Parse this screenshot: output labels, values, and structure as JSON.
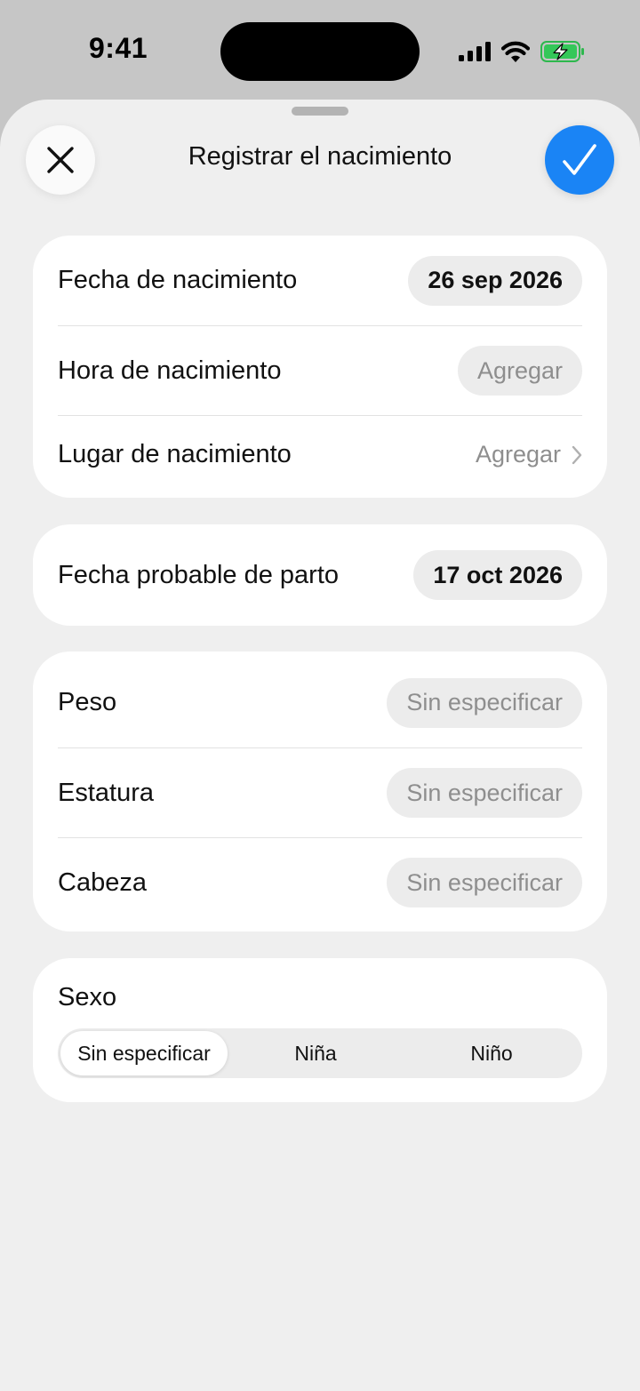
{
  "status_bar": {
    "time": "9:41"
  },
  "header": {
    "title": "Registrar el nacimiento",
    "close_icon": "close-icon",
    "confirm_icon": "checkmark-icon",
    "accent_color": "#1a84f5"
  },
  "birth_card": {
    "fecha_label": "Fecha de nacimiento",
    "fecha_value": "26 sep 2026",
    "hora_label": "Hora de nacimiento",
    "hora_value": "Agregar",
    "lugar_label": "Lugar de nacimiento",
    "lugar_value": "Agregar"
  },
  "due_card": {
    "label": "Fecha probable de parto",
    "value": "17 oct 2026"
  },
  "measures_card": {
    "peso_label": "Peso",
    "peso_value": "Sin especificar",
    "estatura_label": "Estatura",
    "estatura_value": "Sin especificar",
    "cabeza_label": "Cabeza",
    "cabeza_value": "Sin especificar"
  },
  "sex_card": {
    "label": "Sexo",
    "options": [
      "Sin especificar",
      "Niña",
      "Niño"
    ],
    "selected": "Sin especificar"
  }
}
